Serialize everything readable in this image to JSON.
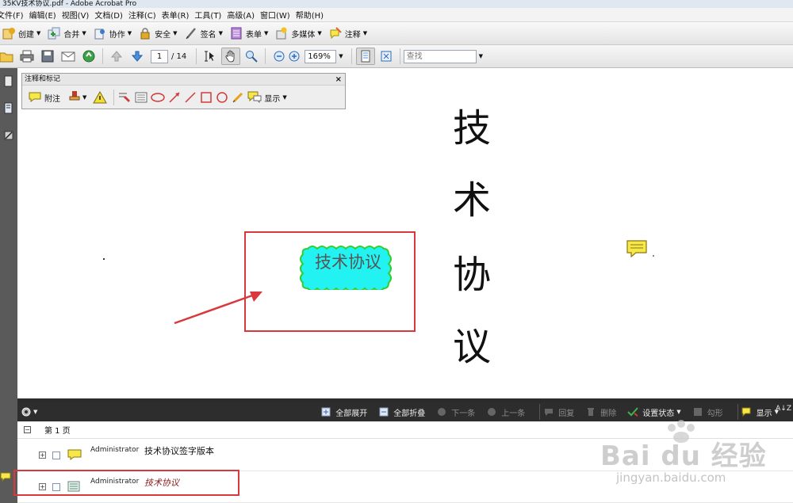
{
  "window": {
    "title": "35KV技术协议.pdf - Adobe Acrobat Pro"
  },
  "menu": [
    "文件(F)",
    "编辑(E)",
    "视图(V)",
    "文档(D)",
    "注释(C)",
    "表单(R)",
    "工具(T)",
    "高级(A)",
    "窗口(W)",
    "帮助(H)"
  ],
  "toolbar": {
    "create": "创建",
    "combine": "合并",
    "collaborate": "协作",
    "secure": "安全",
    "sign": "签名",
    "forms": "表单",
    "multimedia": "多媒体",
    "comment": "注释"
  },
  "nav": {
    "current_page": "1",
    "total_pages": "/ 14",
    "zoom": "169%",
    "find_placeholder": "查找"
  },
  "markup_panel": {
    "title": "注释和标记",
    "sticky_note": "附注",
    "show": "显示"
  },
  "document": {
    "vertical_text": [
      "技",
      "术",
      "协",
      "议"
    ],
    "cloud_text": "技术协议"
  },
  "comments_toolbar": {
    "expand_all": "全部展开",
    "collapse_all": "全部折叠",
    "next": "下一条",
    "prev": "上一条",
    "reply": "回复",
    "delete": "删除",
    "set_status": "设置状态",
    "checkmark": "勾形",
    "show": "显示"
  },
  "comments_list": {
    "page_label": "第 1 页",
    "items": [
      {
        "author": "Administrator",
        "text": "技术协议签字版本"
      },
      {
        "author": "Administrator",
        "text": "技术协议"
      }
    ]
  },
  "watermark": {
    "brand": "Bai du 经验",
    "url": "jingyan.baidu.com"
  },
  "colors": {
    "accent_red": "#d9383c",
    "cloud_fill": "#22f2f2",
    "cloud_stroke": "#2fcf2f",
    "note_yellow": "#f7e84a"
  }
}
